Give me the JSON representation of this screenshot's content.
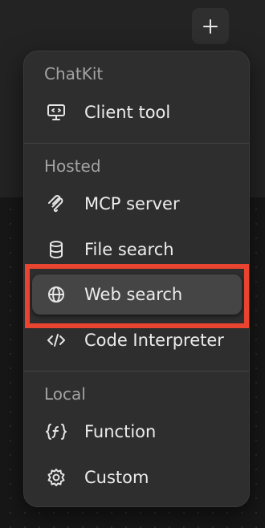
{
  "menu": {
    "sections": [
      {
        "title": "ChatKit",
        "items": [
          {
            "label": "Client tool",
            "icon": "monitor-icon"
          }
        ]
      },
      {
        "title": "Hosted",
        "items": [
          {
            "label": "MCP server",
            "icon": "mcp-icon"
          },
          {
            "label": "File search",
            "icon": "database-icon"
          },
          {
            "label": "Web search",
            "icon": "globe-icon"
          },
          {
            "label": "Code Interpreter",
            "icon": "code-icon"
          }
        ]
      },
      {
        "title": "Local",
        "items": [
          {
            "label": "Function",
            "icon": "function-icon"
          },
          {
            "label": "Custom",
            "icon": "gear-icon"
          }
        ]
      }
    ]
  },
  "colors": {
    "menu_bg": "#2e2e2e",
    "active_item_bg": "#454545",
    "highlight_border": "#e8442f"
  }
}
